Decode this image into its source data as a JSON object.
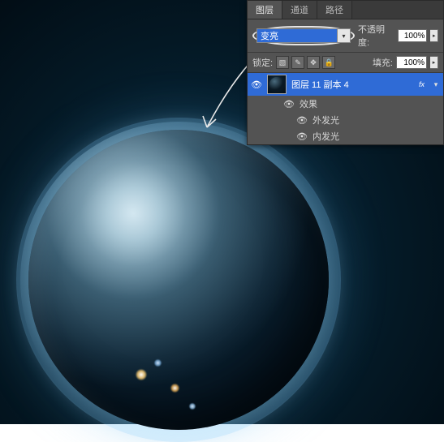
{
  "panel": {
    "tabs": {
      "layers": "图层",
      "channels": "通道",
      "paths": "路径"
    },
    "blend_mode": "变亮",
    "opacity_label": "不透明度:",
    "opacity_value": "100%",
    "lock_label": "锁定:",
    "fill_label": "填充:",
    "fill_value": "100%"
  },
  "layer": {
    "name": "图层 11 副本 4",
    "fx_badge": "fx",
    "effects_label": "效果",
    "effects": {
      "outer_glow": "外发光",
      "inner_glow": "内发光"
    }
  }
}
